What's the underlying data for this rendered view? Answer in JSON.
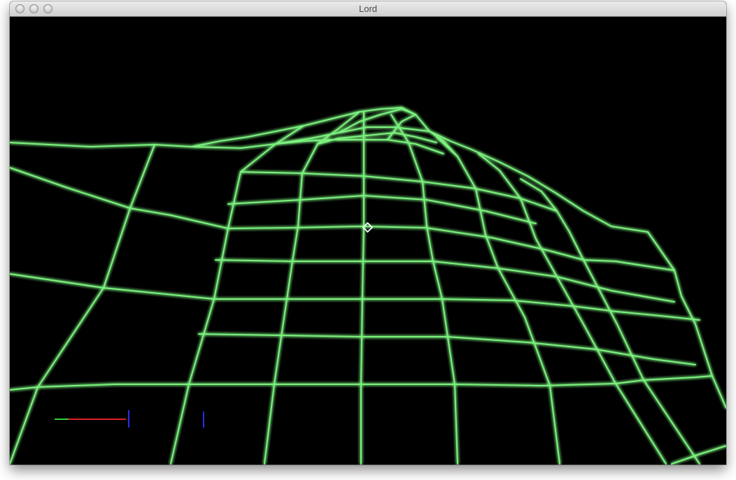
{
  "window": {
    "title": "Lord",
    "buttons": [
      "close",
      "minimize",
      "zoom"
    ]
  },
  "scene": {
    "background_color": "#000000",
    "mesh_color": "#7cf27f",
    "mesh_glow_color": "#39ff4a",
    "crosshair_color": "#ffffff",
    "axis_colors": {
      "x": "#e0202a",
      "y": "#2fd03a",
      "z": "#2b2bf0"
    }
  }
}
